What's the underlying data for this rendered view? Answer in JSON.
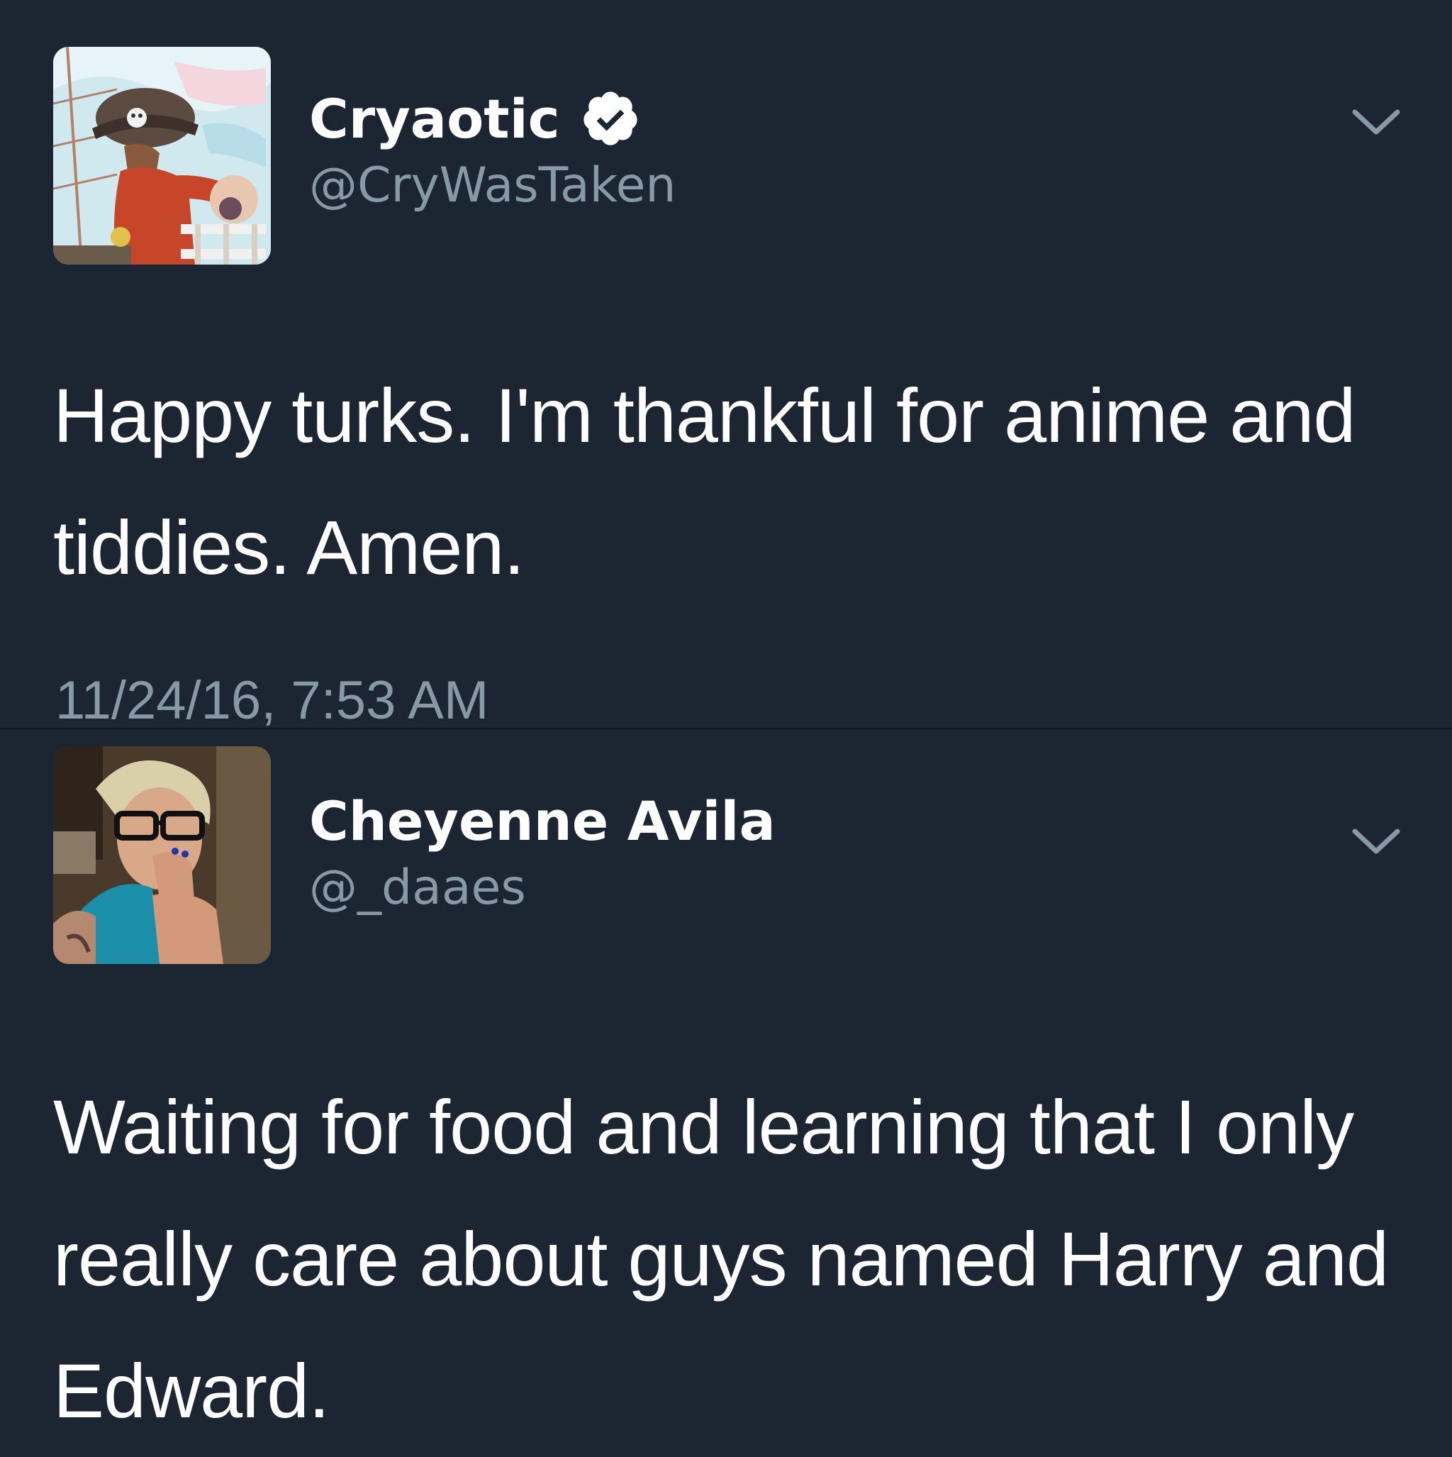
{
  "colors": {
    "background": "#1c2633",
    "text_primary": "#ffffff",
    "text_secondary": "#8899a6",
    "verified_badge": "#ffffff"
  },
  "tweets": [
    {
      "display_name": "Cryaotic",
      "verified": true,
      "handle": "@CryWasTaken",
      "text": "Happy turks. I'm thankful for anime and tiddies. Amen.",
      "timestamp": "11/24/16, 7:53 AM",
      "avatar_icon": "cartoon-pirate-avatar",
      "menu_icon": "chevron-down-icon"
    },
    {
      "display_name": "Cheyenne Avila",
      "verified": false,
      "handle": "@_daaes",
      "text": "Waiting for food and learning that I only really care about guys named Harry and Edward.",
      "avatar_icon": "user-photo-avatar",
      "menu_icon": "chevron-down-icon"
    }
  ]
}
